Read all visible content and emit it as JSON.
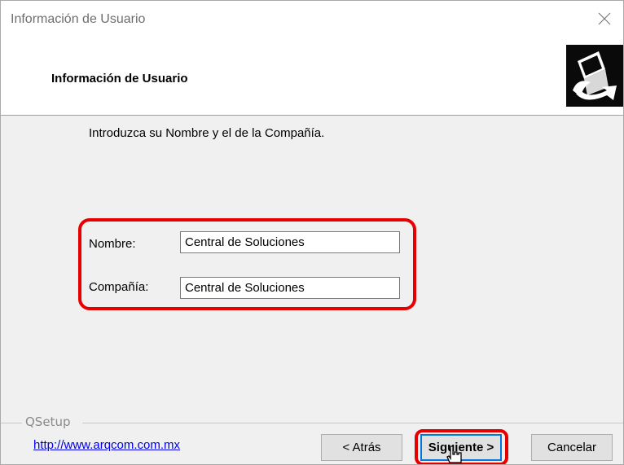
{
  "window": {
    "title": "Información de Usuario"
  },
  "header": {
    "title": "Información de Usuario",
    "logo_icon": "computer-setup-icon"
  },
  "intro": {
    "text": "Introduzca su Nombre y el de la Compañía."
  },
  "form": {
    "name_label": "Nombre:",
    "name_value": "Central de Soluciones",
    "company_label": "Compañía:",
    "company_value": "Central de Soluciones"
  },
  "footer": {
    "group_label": "QSetup",
    "link": "http://www.arqcom.com.mx",
    "back_label": "< Atrás",
    "next_label": "Siguiente >",
    "cancel_label": "Cancelar"
  },
  "colors": {
    "highlight": "#e60000",
    "link": "#0000ee"
  }
}
